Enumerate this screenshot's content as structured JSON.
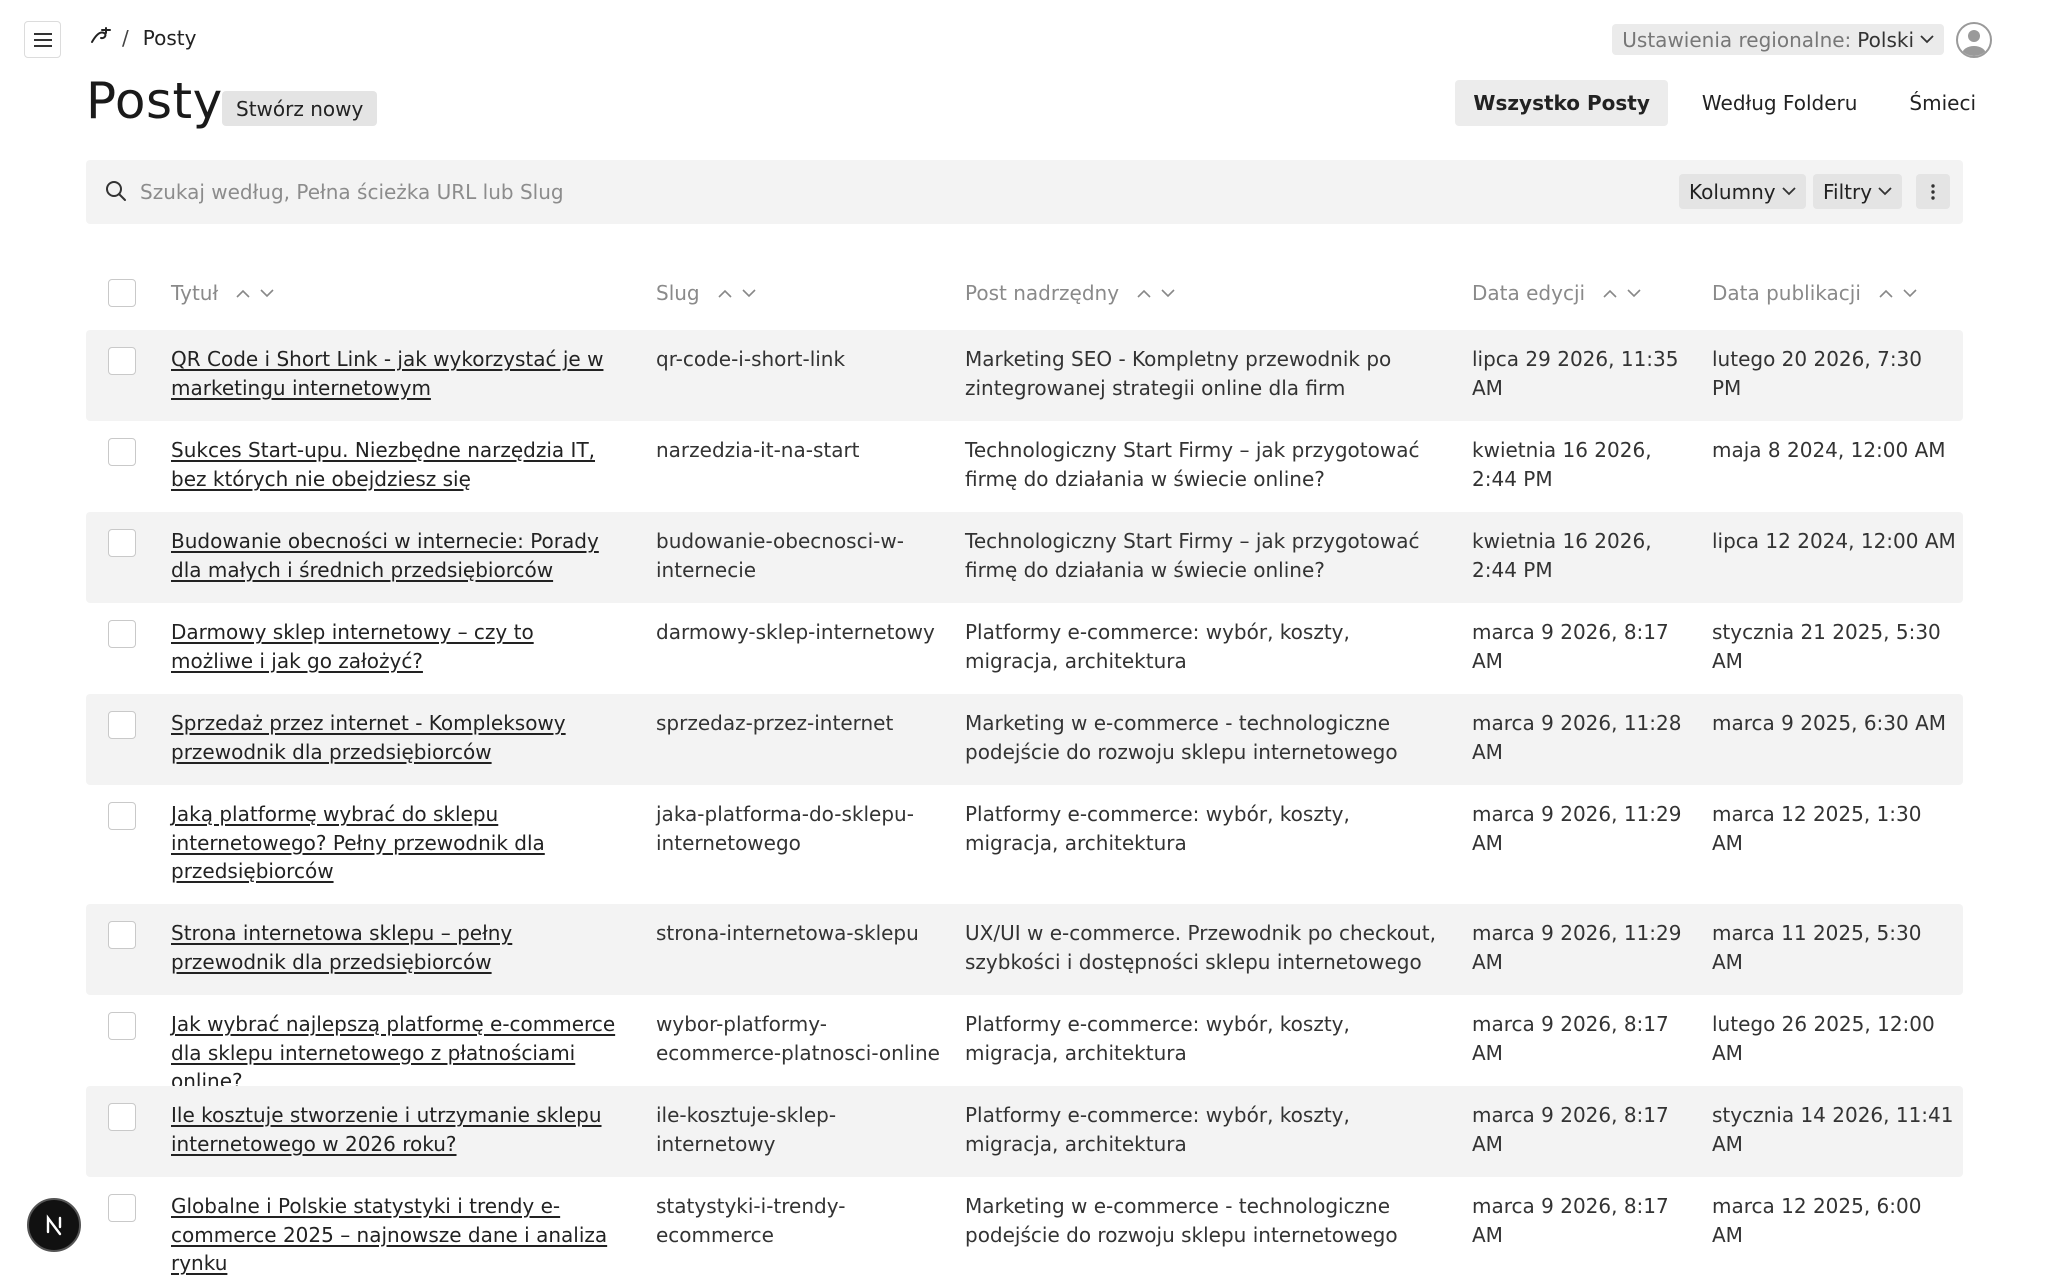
{
  "breadcrumb": {
    "current": "Posty"
  },
  "locale": {
    "label": "Ustawienia regionalne:",
    "value": "Polski"
  },
  "page": {
    "title": "Posty",
    "create_label": "Stwórz nowy"
  },
  "view_tabs": [
    {
      "label": "Wszystko Posty",
      "active": true
    },
    {
      "label": "Według Folderu",
      "active": false
    },
    {
      "label": "Śmieci",
      "active": false
    }
  ],
  "search": {
    "placeholder": "Szukaj według, Pełna ścieżka URL lub Slug",
    "columns_label": "Kolumny",
    "filters_label": "Filtry"
  },
  "table": {
    "headers": {
      "title": "Tytuł",
      "slug": "Slug",
      "parent": "Post nadrzędny",
      "edited": "Data edycji",
      "published": "Data publikacji"
    },
    "rows": [
      {
        "title": "QR Code i Short Link - jak wykorzystać je w marketingu internetowym",
        "slug": "qr-code-i-short-link",
        "parent": "Marketing SEO - Kompletny przewodnik po zintegrowanej strategii online dla firm",
        "edited": "lipca 29 2026, 11:35 AM",
        "published": "lutego 20 2026, 7:30 PM"
      },
      {
        "title": "Sukces Start-upu. Niezbędne narzędzia IT, bez których nie obejdziesz się",
        "slug": "narzedzia-it-na-start",
        "parent": "Technologiczny Start Firmy – jak przygotować firmę do działania w świecie online?",
        "edited": "kwietnia 16 2026, 2:44 PM",
        "published": "maja 8 2024, 12:00 AM"
      },
      {
        "title": "Budowanie obecności w internecie: Porady dla małych i średnich przedsiębiorców",
        "slug": "budowanie-obecnosci-w-internecie",
        "parent": "Technologiczny Start Firmy – jak przygotować firmę do działania w świecie online?",
        "edited": "kwietnia 16 2026, 2:44 PM",
        "published": "lipca 12 2024, 12:00 AM"
      },
      {
        "title": "Darmowy sklep internetowy – czy to możliwe i jak go założyć?",
        "slug": "darmowy-sklep-internetowy",
        "parent": "Platformy e-commerce: wybór, koszty, migracja, architektura",
        "edited": "marca 9 2026, 8:17 AM",
        "published": "stycznia 21 2025, 5:30 AM"
      },
      {
        "title": "Sprzedaż przez internet - Kompleksowy przewodnik dla przedsiębiorców",
        "slug": "sprzedaz-przez-internet",
        "parent": "Marketing w e-commerce - technologiczne podejście do rozwoju sklepu internetowego",
        "edited": "marca 9 2026, 11:28 AM",
        "published": "marca 9 2025, 6:30 AM"
      },
      {
        "title": "Jaką platformę wybrać do sklepu internetowego? Pełny przewodnik dla przedsiębiorców",
        "slug": "jaka-platforma-do-sklepu-internetowego",
        "parent": "Platformy e-commerce: wybór, koszty, migracja, architektura",
        "edited": "marca 9 2026, 11:29 AM",
        "published": "marca 12 2025, 1:30 AM"
      },
      {
        "title": "Strona internetowa sklepu – pełny przewodnik dla przedsiębiorców",
        "slug": "strona-internetowa-sklepu",
        "parent": "UX/UI w e-commerce. Przewodnik po checkout, szybkości i dostępności sklepu internetowego",
        "edited": "marca 9 2026, 11:29 AM",
        "published": "marca 11 2025, 5:30 AM"
      },
      {
        "title": "Jak wybrać najlepszą platformę e-commerce dla sklepu internetowego z płatnościami online?",
        "slug": "wybor-platformy-ecommerce-platnosci-online",
        "parent": "Platformy e-commerce: wybór, koszty, migracja, architektura",
        "edited": "marca 9 2026, 8:17 AM",
        "published": "lutego 26 2025, 12:00 AM"
      },
      {
        "title": "Ile kosztuje stworzenie i utrzymanie sklepu internetowego w 2026 roku?",
        "slug": "ile-kosztuje-sklep-internetowy",
        "parent": "Platformy e-commerce: wybór, koszty, migracja, architektura",
        "edited": "marca 9 2026, 8:17 AM",
        "published": "stycznia 14 2026, 11:41 AM"
      },
      {
        "title": "Globalne i Polskie statystyki i trendy e-commerce 2025 – najnowsze dane i analiza rynku",
        "slug": "statystyki-i-trendy-ecommerce",
        "parent": "Marketing w e-commerce - technologiczne podejście do rozwoju sklepu internetowego",
        "edited": "marca 9 2026, 8:17 AM",
        "published": "marca 12 2025, 6:00 AM"
      }
    ]
  },
  "icons": [
    "menu-icon",
    "logo-icon",
    "chevron-down-icon",
    "avatar-icon",
    "search-icon",
    "sort-asc-icon",
    "sort-desc-icon",
    "kebab-icon",
    "nextjs-icon"
  ]
}
